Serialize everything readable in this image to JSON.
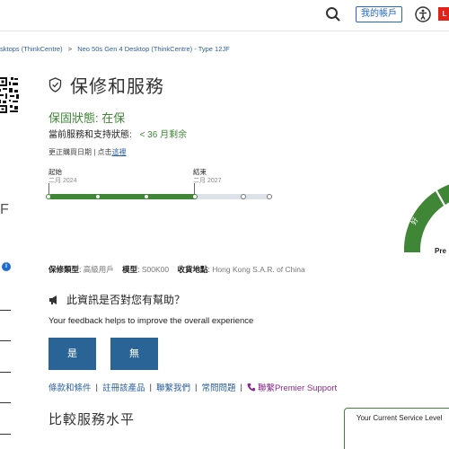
{
  "header": {
    "account_label": "我的帳戶",
    "logo_text": "L",
    "brand_color": "#e2231a",
    "icons": [
      "search-icon",
      "accessibility-icon"
    ]
  },
  "breadcrumb": {
    "items": [
      "sktops (ThinkCentre)",
      "Neo 50s Gen 4 Desktop (ThinkCentre) - Type 12JF"
    ],
    "separator": ">"
  },
  "sidebar": {
    "letter": "F"
  },
  "warranty": {
    "title": "保修和服務",
    "status_label": "保固狀態:",
    "status_value": "在保",
    "current_label": "當前服務和支持狀態:",
    "current_value": "< 36 月剩余",
    "update_prefix": "更正購買日期 | 点击",
    "update_link": "這裡",
    "accent_color": "#3f8636"
  },
  "timeline": {
    "start_label": "起始",
    "start_date": "二月 2024",
    "end_label": "結束",
    "end_date": "二月 2027",
    "progress": 0.66
  },
  "gauge": {
    "label": "Pre",
    "segment_text": "好"
  },
  "details": {
    "type_label": "保修類型",
    "type_value": "高級用戶",
    "model_label": "模型",
    "model_value": "S00K00",
    "location_label": "收貨地點",
    "location_value": "Hong Kong S.A.R. of China"
  },
  "feedback": {
    "question": "此資訊是否對您有幫助？",
    "subtitle": "Your feedback helps to improve the overall experience",
    "yes_label": "是",
    "no_label": "無",
    "button_color": "#2a6496"
  },
  "links": {
    "terms": "條款和條件",
    "register": "註冊該產品",
    "contact": "聯繫我們",
    "faq": "常問問題",
    "premier": "聯繫Premier Support",
    "premier_color": "#8b2a8e"
  },
  "compare": {
    "title": "比較服務水平"
  },
  "service_panel": {
    "label": "Your Current Service Level"
  }
}
